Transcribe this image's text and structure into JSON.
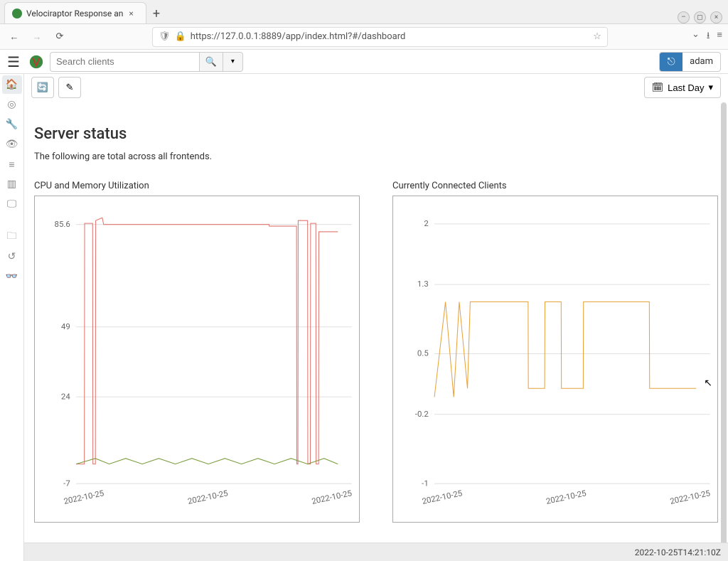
{
  "browser": {
    "tab_title": "Velociraptor Response an",
    "url_display": "https://127.0.0.1:8889/app/index.html?#/dashboard",
    "url_host": "127.0.0.1"
  },
  "header": {
    "search_placeholder": "Search clients",
    "username": "adam"
  },
  "sidebar": {
    "items": [
      {
        "name": "home",
        "icon": "🏠",
        "active": true
      },
      {
        "name": "target",
        "icon": "◎",
        "active": false
      },
      {
        "name": "tools",
        "icon": "🔧",
        "active": false
      },
      {
        "name": "view",
        "icon": "👁",
        "active": false
      },
      {
        "name": "list",
        "icon": "≡",
        "active": false
      },
      {
        "name": "book",
        "icon": "▥",
        "active": false
      },
      {
        "name": "monitor",
        "icon": "🖵",
        "active": false
      },
      {
        "name": "folder",
        "icon": "🗀",
        "active": false
      },
      {
        "name": "history",
        "icon": "↺",
        "active": false
      },
      {
        "name": "binoculars",
        "icon": "👓",
        "active": false
      }
    ]
  },
  "toolbar": {
    "refresh_title": "Refresh",
    "edit_title": "Edit",
    "range_label": "Last Day"
  },
  "page": {
    "heading": "Server status",
    "subtext": "The following are total across all frontends.",
    "timestamp": "2022-10-25T14:21:10Z"
  },
  "chart_data": [
    {
      "type": "line",
      "title": "CPU and Memory Utilization",
      "ylim": [
        -7,
        92
      ],
      "yticks": [
        -7,
        24,
        49,
        85.6
      ],
      "xlabel": "",
      "ylabel": "",
      "xticks": [
        "2022-10-25",
        "2022-10-25",
        "2022-10-25"
      ],
      "series": [
        {
          "name": "CPU",
          "color": "#e0746e",
          "values": [
            [
              0.0,
              0
            ],
            [
              0.03,
              0
            ],
            [
              0.031,
              86
            ],
            [
              0.06,
              86
            ],
            [
              0.061,
              0
            ],
            [
              0.07,
              0
            ],
            [
              0.071,
              87
            ],
            [
              0.095,
              88
            ],
            [
              0.1,
              85.6
            ],
            [
              0.7,
              85.6
            ],
            [
              0.701,
              85
            ],
            [
              0.8,
              85
            ],
            [
              0.801,
              0
            ],
            [
              0.805,
              0
            ],
            [
              0.806,
              87
            ],
            [
              0.84,
              87
            ],
            [
              0.841,
              0
            ],
            [
              0.85,
              0
            ],
            [
              0.851,
              86
            ],
            [
              0.87,
              86
            ],
            [
              0.871,
              0
            ],
            [
              0.88,
              0
            ],
            [
              0.881,
              83
            ],
            [
              0.92,
              83
            ],
            [
              0.93,
              83
            ],
            [
              0.95,
              83
            ]
          ]
        },
        {
          "name": "Memory",
          "color": "#7a9c3b",
          "values": [
            [
              0.0,
              0
            ],
            [
              0.07,
              2
            ],
            [
              0.12,
              0
            ],
            [
              0.18,
              2
            ],
            [
              0.24,
              0
            ],
            [
              0.3,
              2
            ],
            [
              0.36,
              0
            ],
            [
              0.42,
              2
            ],
            [
              0.48,
              0
            ],
            [
              0.54,
              2
            ],
            [
              0.6,
              0
            ],
            [
              0.66,
              2
            ],
            [
              0.72,
              0
            ],
            [
              0.78,
              2
            ],
            [
              0.84,
              0
            ],
            [
              0.9,
              2
            ],
            [
              0.95,
              0
            ]
          ]
        }
      ]
    },
    {
      "type": "line",
      "title": "Currently Connected Clients",
      "ylim": [
        -1,
        2.2
      ],
      "yticks": [
        -1,
        -0.2,
        0.5,
        1.3,
        2
      ],
      "xlabel": "",
      "ylabel": "",
      "xticks": [
        "2022-10-25",
        "2022-10-25",
        "2022-10-25"
      ],
      "series": [
        {
          "name": "clients",
          "color": "#e8a23c",
          "values": [
            [
              0.0,
              0
            ],
            [
              0.04,
              1.1
            ],
            [
              0.07,
              0
            ],
            [
              0.09,
              1.1
            ],
            [
              0.12,
              0.1
            ],
            [
              0.13,
              1.1
            ],
            [
              0.34,
              1.1
            ],
            [
              0.341,
              0.1
            ],
            [
              0.4,
              0.1
            ],
            [
              0.401,
              1.1
            ],
            [
              0.46,
              1.1
            ],
            [
              0.461,
              0.1
            ],
            [
              0.54,
              0.1
            ],
            [
              0.541,
              1.1
            ],
            [
              0.78,
              1.1
            ],
            [
              0.781,
              0.1
            ],
            [
              0.95,
              0.1
            ]
          ]
        }
      ]
    }
  ]
}
